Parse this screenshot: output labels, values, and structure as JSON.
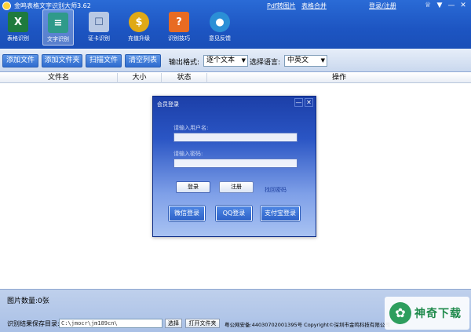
{
  "app": {
    "title": "金鸣表格文字识别大师3.62",
    "links": {
      "pdf_to_image": "Pdf转图片",
      "table_merge": "表格合并",
      "login_register": "登录/注册"
    },
    "window_controls": {
      "shirt": "♕",
      "menu": "▼",
      "minimize": "—",
      "close": "✕"
    }
  },
  "toolbar_icons": [
    {
      "label": "表格识别",
      "glyph": "X",
      "color": "#1e7a3e",
      "icon": "excel-icon"
    },
    {
      "label": "文字识别",
      "glyph": "≡",
      "color": "#2f9a8a",
      "icon": "document-icon"
    },
    {
      "label": "证卡识别",
      "glyph": "☐",
      "color": "#b9c9e4",
      "icon": "id-card-icon"
    },
    {
      "label": "充值升级",
      "glyph": "$",
      "color": "#e0a916",
      "icon": "coin-icon"
    },
    {
      "label": "识别技巧",
      "glyph": "?",
      "color": "#e86b22",
      "icon": "help-icon"
    },
    {
      "label": "意见反馈",
      "glyph": "●",
      "color": "#2b8fd6",
      "icon": "feedback-icon"
    }
  ],
  "actions": {
    "add_file": "添加文件",
    "add_folder": "添加文件夹",
    "scan_file": "扫描文件",
    "clear_list": "清空列表"
  },
  "output": {
    "format_label": "输出格式:",
    "format_value": "逐个文本",
    "language_label": "选择语言:",
    "language_value": "中英文"
  },
  "table": {
    "columns": [
      "文件名",
      "大小",
      "状态",
      "操作"
    ]
  },
  "bottom": {
    "image_count": "图片数量:0张",
    "save_dir_label": "识别结果保存目录:",
    "save_path": "C:\\jmocr\\jm189cn\\",
    "choose_btn": "选择",
    "open_folder_btn": "打开文件夹",
    "footer": "粤公网安备:44030702001395号  Copyright©深圳市金鸣科技有限公司"
  },
  "watermark": {
    "text": "神奇下载",
    "glyph": "✿"
  },
  "dialog": {
    "title": "会员登录",
    "minimize": "—",
    "close": "✕",
    "username_placeholder": "请输入用户名:",
    "password_placeholder": "请输入密码:",
    "login": "登录",
    "register": "注册",
    "forgot": "找回密码",
    "wechat_login": "微信登录",
    "qq_login": "QQ登录",
    "alipay_login": "支付宝登录"
  }
}
